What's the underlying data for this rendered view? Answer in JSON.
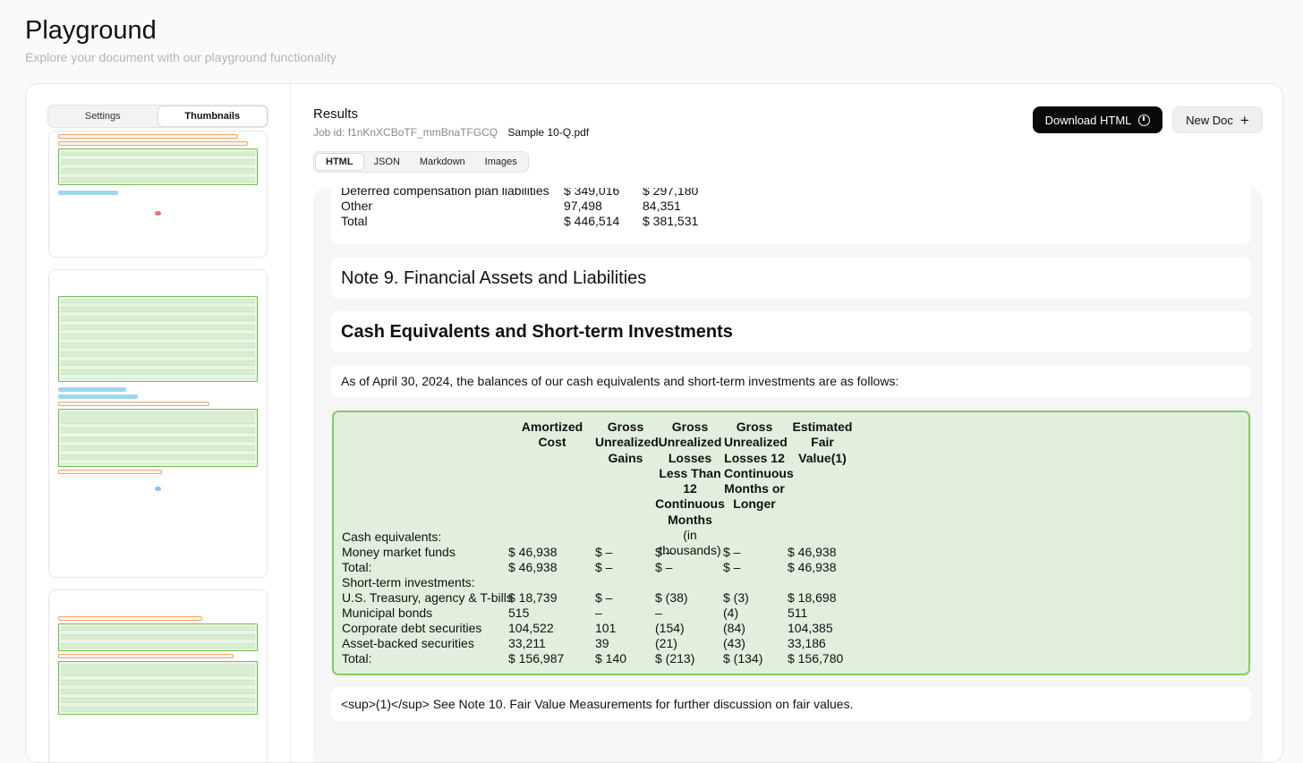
{
  "header": {
    "title": "Playground",
    "subtitle": "Explore your document with our playground functionality"
  },
  "left_panel": {
    "tabs": [
      {
        "label": "Settings",
        "active": false
      },
      {
        "label": "Thumbnails",
        "active": true
      }
    ]
  },
  "results": {
    "title": "Results",
    "job_label": "Job id: f1nKnXCBoTF_mmBnaTFGCQ",
    "file_name": "Sample 10-Q.pdf",
    "download_label": "Download HTML",
    "new_doc_label": "New Doc",
    "tabs": [
      {
        "label": "HTML",
        "active": true
      },
      {
        "label": "JSON",
        "active": false
      },
      {
        "label": "Markdown",
        "active": false
      },
      {
        "label": "Images",
        "active": false
      }
    ]
  },
  "document": {
    "top_rows": [
      {
        "label": "Deferred compensation plan liabilities",
        "v1": "$ 349,016",
        "v2": "$ 297,180"
      },
      {
        "label": "Other",
        "v1": "97,498",
        "v2": "84,351"
      },
      {
        "label": "Total",
        "v1": "$ 446,514",
        "v2": "$ 381,531"
      }
    ],
    "note_heading": "Note 9. Financial Assets and Liabilities",
    "section_heading": "Cash Equivalents and Short-term Investments",
    "paragraph": "As of April 30, 2024, the balances of our cash equivalents and short-term investments are as follows:",
    "table": {
      "headers": {
        "amortized": "Amortized Cost",
        "gains": "Gross Unrealized Gains",
        "losses_lt": "Gross Unrealized Losses Less Than 12 Continuous Months",
        "in_thousands": "(in thousands)",
        "losses_gt": "Gross Unrealized Losses 12 Continuous Months or Longer",
        "fair": "Estimated Fair Value(1)"
      },
      "rows": [
        {
          "label": "Cash equivalents:",
          "c1": "",
          "c2": "",
          "c3": "",
          "c4": "",
          "c5": ""
        },
        {
          "label": "Money market funds",
          "c1": "$ 46,938",
          "c2": "$ –",
          "c3": "$ –",
          "c4": "$ –",
          "c5": "$ 46,938"
        },
        {
          "label": "Total:",
          "c1": "$ 46,938",
          "c2": "$ –",
          "c3": "$ –",
          "c4": "$ –",
          "c5": "$ 46,938"
        },
        {
          "label": "Short-term investments:",
          "c1": "",
          "c2": "",
          "c3": "",
          "c4": "",
          "c5": ""
        },
        {
          "label": "U.S. Treasury, agency & T-bills",
          "c1": "$ 18,739",
          "c2": "$ –",
          "c3": "$ (38)",
          "c4": "$ (3)",
          "c5": "$ 18,698"
        },
        {
          "label": "Municipal bonds",
          "c1": "515",
          "c2": "–",
          "c3": "–",
          "c4": "(4)",
          "c5": "511"
        },
        {
          "label": "Corporate debt securities",
          "c1": "104,522",
          "c2": "101",
          "c3": "(154)",
          "c4": "(84)",
          "c5": "104,385"
        },
        {
          "label": "Asset-backed securities",
          "c1": "33,211",
          "c2": "39",
          "c3": "(21)",
          "c4": "(43)",
          "c5": "33,186"
        },
        {
          "label": "Total:",
          "c1": "$ 156,987",
          "c2": "$ 140",
          "c3": "$ (213)",
          "c4": "$ (134)",
          "c5": "$ 156,780"
        }
      ]
    },
    "footnote": "<sup>(1)</sup> See Note 10. Fair Value Measurements for further discussion on fair values."
  }
}
